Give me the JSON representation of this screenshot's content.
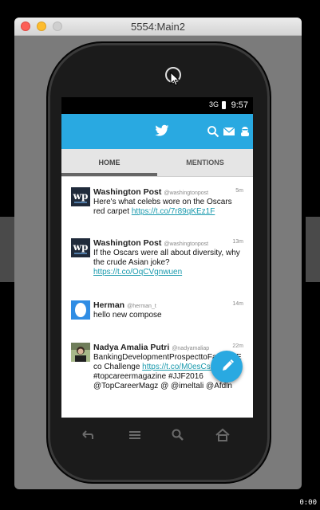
{
  "window": {
    "title": "5554:Main2"
  },
  "statusbar": {
    "signal": "3G",
    "time": "9:57"
  },
  "tabs": {
    "home": "HOME",
    "mentions": "MENTIONS"
  },
  "tweets": [
    {
      "name": "Washington Post",
      "handle": "@washingtonpost",
      "time": "5m",
      "text": "Here's what celebs wore on the Oscars red carpet ",
      "link": "https://t.co/7r89qKEz1F"
    },
    {
      "name": "Washington Post",
      "handle": "@washingtonpost",
      "time": "13m",
      "text": "If the Oscars were all about diversity, why the crude Asian joke? ",
      "link": "https://t.co/OqCVgnwuen"
    },
    {
      "name": "Herman",
      "handle": "@herman_t",
      "time": "14m",
      "text": "hello new compose",
      "link": ""
    },
    {
      "name": "Nadya Amalia Putri",
      "handle": "@nadyamaliap",
      "time": "22m",
      "text": "BankingDevelopmentProspecttoFacetheEco Challenge ",
      "link": "https://t.co/M0esCszclY",
      "text2": " #topcareermagazine #JJF2016 @TopCareerMagz @ @imeltali @Afdln"
    }
  ],
  "bottom_clock": "0:00",
  "colors": {
    "accent": "#29a9e1",
    "link": "#1a9aad"
  }
}
